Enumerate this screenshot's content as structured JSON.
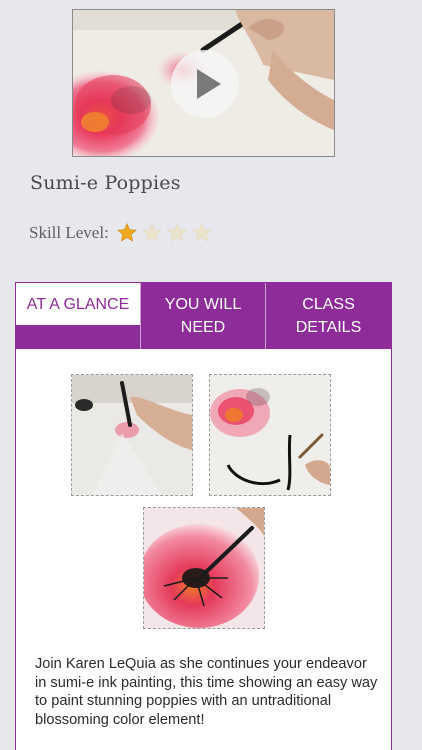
{
  "lesson": {
    "title": "Sumi-e Poppies",
    "skill_label": "Skill Level:",
    "skill_rating": 1,
    "skill_max": 4
  },
  "video": {
    "play_icon": "play-icon"
  },
  "tabs": [
    {
      "label": "AT A GLANCE",
      "active": true
    },
    {
      "label": "YOU WILL\nNEED",
      "active": false
    },
    {
      "label": "CLASS\nDETAILS",
      "active": false
    }
  ],
  "description": "Join Karen LeQuia as she continues your endeavor in sumi-e ink painting, this time showing an easy way to paint stunning poppies with an untraditional blossoming color element!",
  "colors": {
    "accent": "#8e2d9a",
    "background": "#e6e8ed",
    "star_filled": "#f0a81e",
    "star_empty": "#ece3cc"
  }
}
